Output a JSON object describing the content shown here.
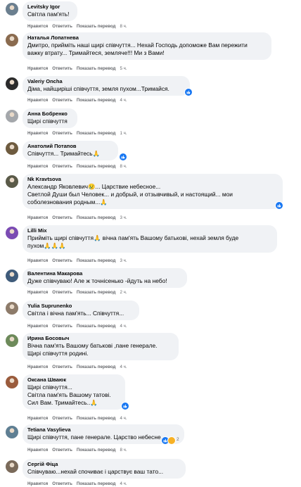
{
  "actions": {
    "like": "Нравится",
    "reply": "Ответить",
    "translate": "Показать перевод"
  },
  "comments": [
    {
      "author": "Levitsky Igor",
      "lines": [
        "Світла пам'ять!"
      ],
      "time": "8 ч."
    },
    {
      "author": "Наталья Лопатнева",
      "lines": [
        "Дмитро, прийміть наші щирі співчуття... Нехай Господь допоможе Вам пережити",
        "важку втрату... Тримайтеся, земляче!!! Ми з Вами!"
      ],
      "time": "5 ч."
    },
    {
      "author": "Valeriy Oncha",
      "lines": [
        "Діма, найщиріші співчуття, земля пухом...Тримайся."
      ],
      "time": "4 ч."
    },
    {
      "author": "Анна Бобренко",
      "lines": [
        "Щирі співчуття"
      ],
      "time": "1 ч."
    },
    {
      "author": "Анатолий Потапов",
      "lines": [
        "Співчуття... Тримайтесь🙏"
      ],
      "time": "8 ч."
    },
    {
      "author": "Nk Kravtsova",
      "lines": [
        "Александр Яковлевич😢... Царствие небесное...",
        "Светлой Души был Человек... и добрый, и отзывчивый, и настоящий... мои",
        "соболезнования родным...🙏"
      ],
      "time": "3 ч."
    },
    {
      "author": "Lilli Mix",
      "lines": [
        "Прийміть щирі співчуття🙏 вічна пам'ять Вашому батькові, нехай земля буде",
        "пухом🙏🙏🙏"
      ],
      "time": "3 ч."
    },
    {
      "author": "Валентина Макарова",
      "lines": [
        "Дуже співчуваю! Але ж точнісенько -йдуть на небо!"
      ],
      "time": "2 ч."
    },
    {
      "author": "Yulia Suprunenko",
      "lines": [
        "Світла і вічна пам'ять... Співчуття..."
      ],
      "time": "4 ч."
    },
    {
      "author": "Ирина Босовыч",
      "lines": [
        "Вічна пам'ять Вашому батькові ,пане генерале.",
        "Щирі співчуття родині."
      ],
      "time": "4 ч."
    },
    {
      "author": "Оксана Шваюк",
      "lines": [
        "Щирі співчуття...",
        "Світла пам'ять Вашому татові.",
        "Сил Вам. Тримайтесь..🙏"
      ],
      "time": "4 ч."
    },
    {
      "author": "Tetiana Vasylieva",
      "lines": [
        "Щирі співчуття, пане генерале. Царство небесне."
      ],
      "time": "8 ч.",
      "reaction_count": "2"
    },
    {
      "author": "Сергій Фіца",
      "lines": [
        "Співчуваю...нехай спочиває і царствує ваш тато..."
      ],
      "time": "4 ч."
    }
  ],
  "colors": {
    "bubble": "#f0f2f5",
    "meta": "#65676b",
    "like": "#1877f2"
  }
}
